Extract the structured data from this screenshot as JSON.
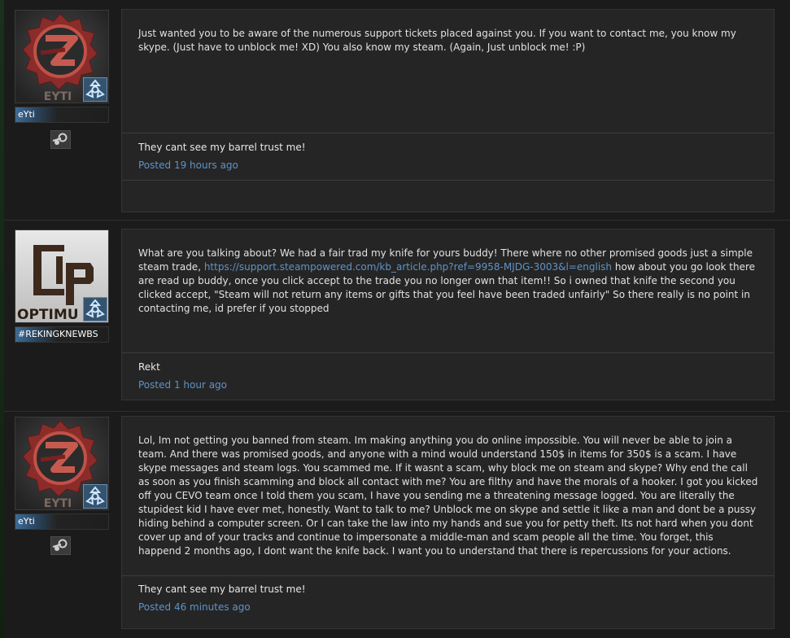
{
  "posts": [
    {
      "username": "eYti",
      "avatar": "eyti-logo",
      "avatar_text": "EYTI",
      "has_steam": true,
      "message": "Just wanted you to be aware of the numerous support tickets placed against you. If you want to contact me, you know my skype. (Just have to unblock me! XD) You also know my steam. (Again, Just unblock me! :P)",
      "signature": "They cant see my barrel trust me!",
      "posted_prefix": "Posted",
      "posted_time": "19 hours ago"
    },
    {
      "username": "#REKINGKNEWBS",
      "avatar": "optimus-logo",
      "avatar_text": "OPTIMU",
      "has_steam": false,
      "message_before": "What are you talking about? We had a fair trad my knife for yours buddy! There where no other promised goods just a simple steam trade, ",
      "message_link": "https://support.steampowered.com/kb_article.php?ref=9958-MJDG-3003&l=english",
      "message_after": " how about you go look there are read up buddy, once you click accept to the trade you no longer own that item!! So i owned that knife the second you clicked accept, \"Steam will not return any items or gifts that you feel have been traded unfairly\" So there really is no point in contacting me, id prefer if you stopped",
      "signature": "Rekt",
      "posted_prefix": "Posted",
      "posted_time": "1 hour ago"
    },
    {
      "username": "eYti",
      "avatar": "eyti-logo",
      "avatar_text": "EYTI",
      "has_steam": true,
      "message": "Lol, Im not getting you banned from steam. Im making anything you do online impossible. You will never be able to join a team. And there was promised goods, and anyone with a mind would understand 150$ in items for 350$ is a scam. I have skype messages and steam logs. You scammed me. If it wasnt a scam, why block me on steam and skype? Why end the call as soon as you finish scamming and block all contact with me? You are filthy and have the morals of a hooker. I got you kicked off you CEVO team once I told them you scam, I have you sending me a threatening message logged. You are literally the stupidest kid I have ever met, honestly. Want to talk to me? Unblock me on skype and settle it like a man and dont be a pussy hiding behind a computer screen. Or I can take the law into my hands and sue you for petty theft. Its not hard when you dont cover up and of your tracks and continue to impersonate a middle-man and scam people all the time. You forget, this happend 2 months ago, I dont want the knife back. I want you to understand that there is repercussions for your actions.",
      "signature": "They cant see my barrel trust me!",
      "posted_prefix": "Posted",
      "posted_time": "46 minutes ago"
    }
  ],
  "colors": {
    "link": "#5f93c8",
    "rank_badge": "#34536f",
    "eyti_red": "#b8483f",
    "optimus_brown": "#3d2a1c"
  },
  "icons": {
    "rank": "rank-badge-icon",
    "steam": "steam-icon"
  }
}
